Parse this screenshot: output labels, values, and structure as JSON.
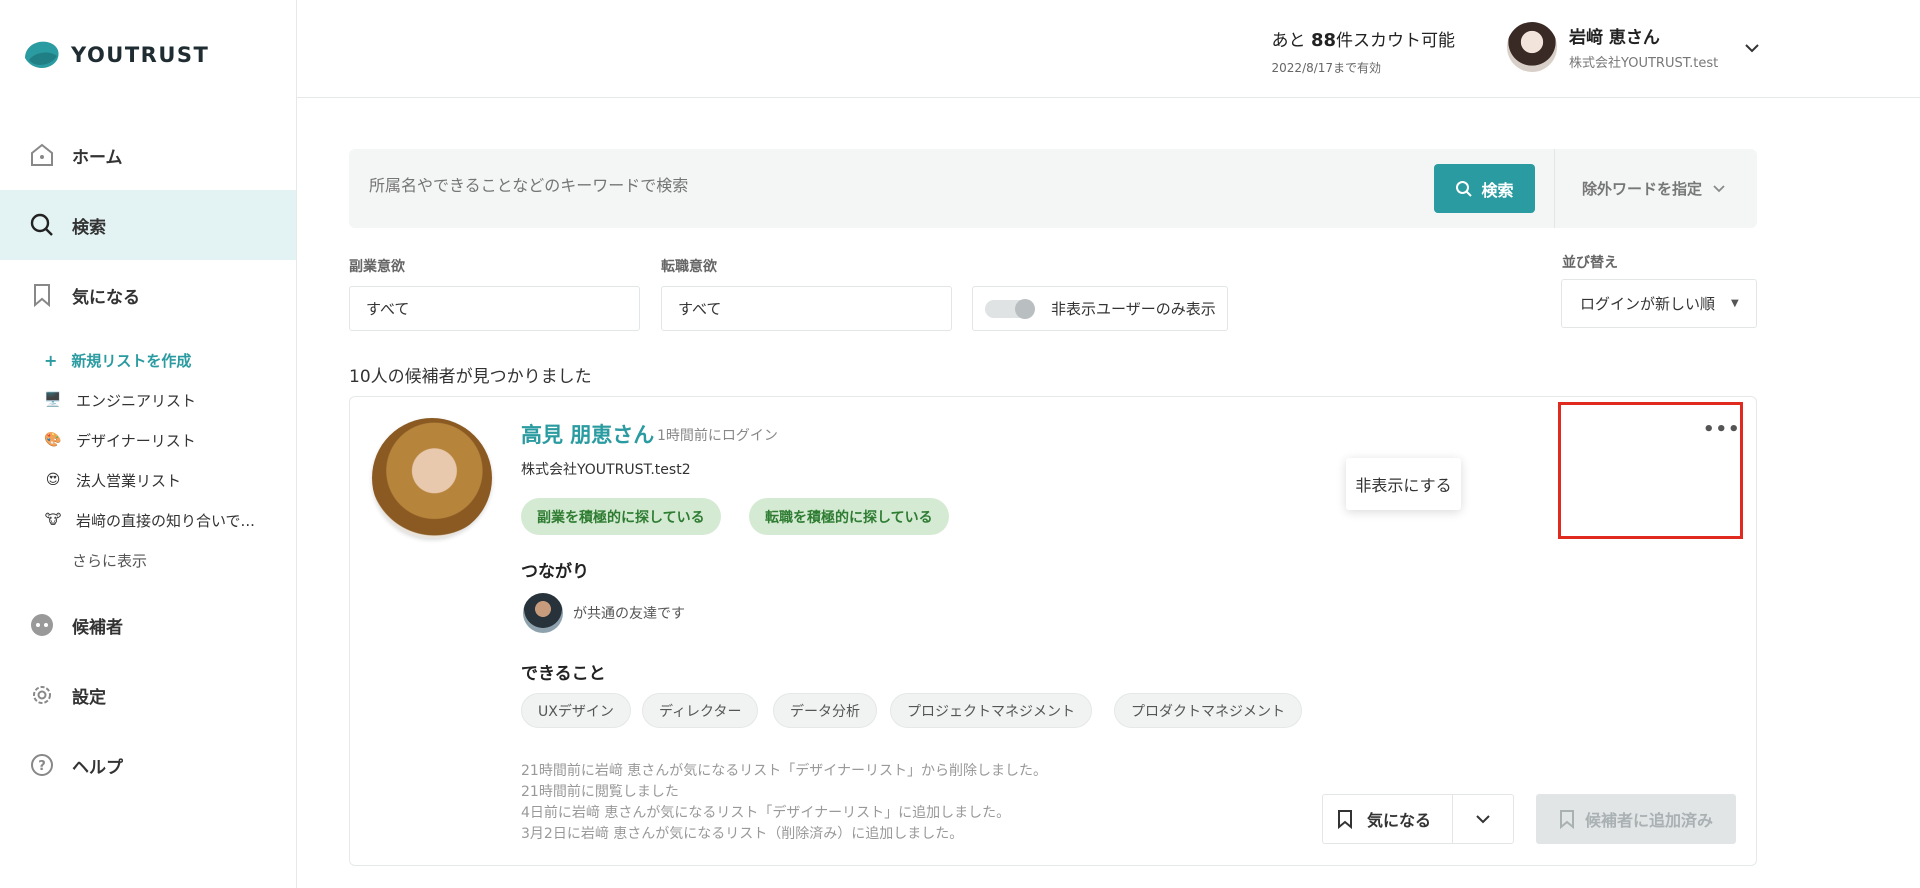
{
  "brand": {
    "name": "YOUTRUST"
  },
  "nav": {
    "home": "ホーム",
    "search": "検索",
    "bookmarks": "気になる",
    "candidates": "候補者",
    "settings": "設定",
    "help": "ヘルプ"
  },
  "lists": {
    "create": "新規リストを作成",
    "items": [
      {
        "emoji": "🖥️",
        "label": "エンジニアリスト"
      },
      {
        "emoji": "🎨",
        "label": "デザイナーリスト"
      },
      {
        "emoji": "😍",
        "label": "法人営業リスト"
      },
      {
        "emoji": "🐮",
        "label": "岩﨑の直接の知り合いで..."
      }
    ],
    "more": "さらに表示"
  },
  "header": {
    "scout_prefix": "あと",
    "scout_count": "88",
    "scout_suffix": "件スカウト可能",
    "scout_valid": "2022/8/17まで有効",
    "user_name": "岩﨑 恵さん",
    "user_company": "株式会社YOUTRUST.test"
  },
  "search": {
    "placeholder": "所属名やできることなどのキーワードで検索",
    "button": "検索",
    "exclude": "除外ワードを指定"
  },
  "filters": {
    "side_job_label": "副業意欲",
    "side_job_value": "すべて",
    "job_change_label": "転職意欲",
    "job_change_value": "すべて",
    "hidden_only": "非表示ユーザーのみ表示",
    "sort_label": "並び替え",
    "sort_value": "ログインが新しい順"
  },
  "results": {
    "count_text": "10人の候補者が見つかりました"
  },
  "candidate": {
    "name": "高見 朋恵さん",
    "last_login": "1時間前にログイン",
    "company": "株式会社YOUTRUST.test2",
    "tags": [
      "副業を積極的に探している",
      "転職を積極的に探している"
    ],
    "connections_title": "つながり",
    "mutual_text": "が共通の友達です",
    "skills_title": "できること",
    "skills": [
      "UXデザイン",
      "ディレクター",
      "データ分析",
      "プロジェクトマネジメント",
      "プロダクトマネジメント"
    ],
    "history": [
      "21時間前に岩﨑 恵さんが気になるリスト「デザイナーリスト」から削除しました。",
      "21時間前に閲覧しました",
      "4日前に岩﨑 恵さんが気になるリスト「デザイナーリスト」に追加しました。",
      "3月2日に岩﨑 恵さんが気になるリスト（削除済み）に追加しました。"
    ],
    "bookmark_button": "気になる",
    "added_button": "候補者に追加済み",
    "menu_hide": "非表示にする"
  },
  "colors": {
    "accent": "#2a9ba0",
    "tag_bg": "#d5ead3",
    "highlight": "#e02a20"
  }
}
